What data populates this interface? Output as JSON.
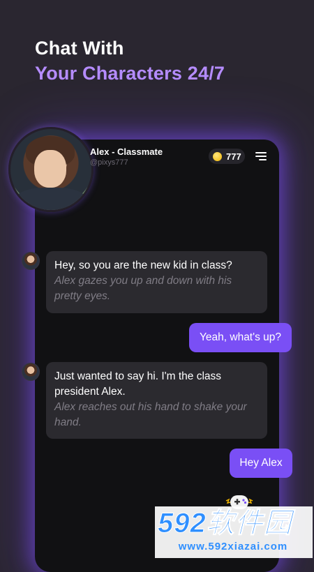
{
  "headline": {
    "line1": "Chat With",
    "line2": "Your Characters 24/7"
  },
  "character": {
    "name": "Alex - Classmate",
    "handle": "@pixys777",
    "avatar_icon": "character-avatar"
  },
  "coins": {
    "count": "777",
    "icon": "coin-icon"
  },
  "messages": [
    {
      "role": "character",
      "text": "Hey, so you are the new kid in class?",
      "action": "Alex gazes you up and down with his pretty eyes."
    },
    {
      "role": "user",
      "text": "Yeah, what's up?"
    },
    {
      "role": "character",
      "text": "Just wanted to say hi. I'm the class president Alex.",
      "action": "Alex reaches out his hand to shake your hand."
    },
    {
      "role": "user",
      "text": "Hey Alex"
    }
  ],
  "watermark": {
    "brand": "592软件园",
    "url": "www.592xiazai.com"
  },
  "colors": {
    "accent": "#7a4ff5",
    "headline_accent": "#b58cff",
    "background": "#2a2630",
    "phone": "#111113",
    "bubble": "#2b2a2f"
  }
}
